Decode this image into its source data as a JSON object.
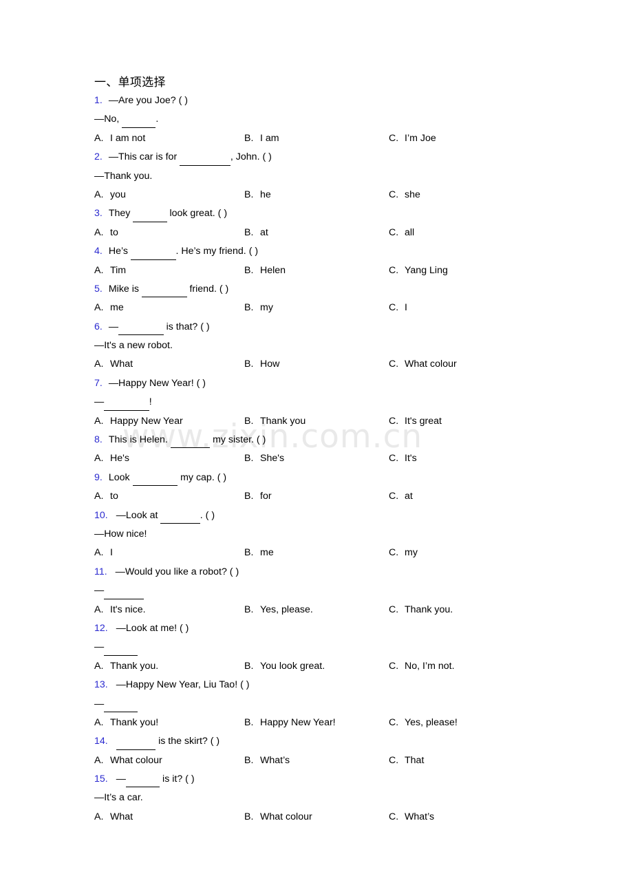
{
  "document": {
    "watermark": "www.zixin.com.cn",
    "heading": "一、单项选择",
    "blue_color": "#2a29cf",
    "text_color": "#000000",
    "watermark_color": "#e9e9e9",
    "background": "#ffffff"
  },
  "questions": [
    {
      "number": "1.",
      "stem": "—Are you Joe? (  )",
      "stem2": "—No, ______.",
      "options": [
        {
          "letter": "A.",
          "text": "I am not"
        },
        {
          "letter": "B.",
          "text": "I am"
        },
        {
          "letter": "C.",
          "text": "I’m Joe"
        }
      ]
    },
    {
      "number": "2.",
      "stem": "—This car is for _________, John. (  )",
      "stem2": "—Thank you.",
      "options": [
        {
          "letter": "A.",
          "text": "you"
        },
        {
          "letter": "B.",
          "text": "he"
        },
        {
          "letter": "C.",
          "text": "she"
        }
      ]
    },
    {
      "number": "3.",
      "stem": "They ______ look great. (  )",
      "stem2": "",
      "options": [
        {
          "letter": "A.",
          "text": "to"
        },
        {
          "letter": "B.",
          "text": "at"
        },
        {
          "letter": "C.",
          "text": "all"
        }
      ]
    },
    {
      "number": "4.",
      "stem": "He’s ________. He’s my friend. (  )",
      "stem2": "",
      "options": [
        {
          "letter": "A.",
          "text": "Tim"
        },
        {
          "letter": "B.",
          "text": "Helen"
        },
        {
          "letter": "C.",
          "text": "Yang Ling"
        }
      ]
    },
    {
      "number": "5.",
      "stem": "Mike is ________ friend. (  )",
      "stem2": "",
      "options": [
        {
          "letter": "A.",
          "text": "me"
        },
        {
          "letter": "B.",
          "text": "my"
        },
        {
          "letter": "C.",
          "text": "I"
        }
      ]
    },
    {
      "number": "6.",
      "stem": "—________ is that? (  )",
      "stem2": "—It's a new robot.",
      "options": [
        {
          "letter": "A.",
          "text": "What"
        },
        {
          "letter": "B.",
          "text": "How"
        },
        {
          "letter": "C.",
          "text": "What colour"
        }
      ]
    },
    {
      "number": "7.",
      "stem": "—Happy New Year! (  )",
      "stem2": "—________!",
      "options": [
        {
          "letter": "A.",
          "text": "Happy New Year"
        },
        {
          "letter": "B.",
          "text": "Thank you"
        },
        {
          "letter": "C.",
          "text": "It's great"
        }
      ]
    },
    {
      "number": "8.",
      "stem": "This is Helen. _______ my sister. (  )",
      "stem2": "",
      "options": [
        {
          "letter": "A.",
          "text": "He's"
        },
        {
          "letter": "B.",
          "text": "She's"
        },
        {
          "letter": "C.",
          "text": "It's"
        }
      ]
    },
    {
      "number": "9.",
      "stem": "Look ________ my cap. (  )",
      "stem2": "",
      "options": [
        {
          "letter": "A.",
          "text": "to"
        },
        {
          "letter": "B.",
          "text": "for"
        },
        {
          "letter": "C.",
          "text": "at"
        }
      ]
    },
    {
      "number": "10.",
      "stem": "—Look at _______. (  )",
      "stem2": "—How nice!",
      "options": [
        {
          "letter": "A.",
          "text": "I"
        },
        {
          "letter": "B.",
          "text": "me"
        },
        {
          "letter": "C.",
          "text": "my"
        }
      ]
    },
    {
      "number": "11.",
      "stem": "—Would you like a robot? (  )",
      "stem2": "—_______",
      "options": [
        {
          "letter": "A.",
          "text": "It's nice."
        },
        {
          "letter": "B.",
          "text": "Yes, please."
        },
        {
          "letter": "C.",
          "text": "Thank you."
        }
      ]
    },
    {
      "number": "12.",
      "stem": "—Look at me! (  )",
      "stem2": "—______",
      "options": [
        {
          "letter": "A.",
          "text": "Thank you."
        },
        {
          "letter": "B.",
          "text": "You look great."
        },
        {
          "letter": "C.",
          "text": "No, I’m not."
        }
      ]
    },
    {
      "number": "13.",
      "stem": "—Happy New Year, Liu Tao! (  )",
      "stem2": "—______",
      "options": [
        {
          "letter": "A.",
          "text": "Thank you!"
        },
        {
          "letter": "B.",
          "text": "Happy New Year!"
        },
        {
          "letter": "C.",
          "text": "Yes, please!"
        }
      ]
    },
    {
      "number": "14.",
      "stem": "_______ is the skirt? (  )",
      "stem2": "",
      "options": [
        {
          "letter": "A.",
          "text": "What colour"
        },
        {
          "letter": "B.",
          "text": "What’s"
        },
        {
          "letter": "C.",
          "text": "That"
        }
      ]
    },
    {
      "number": "15.",
      "stem": "—______ is it? (  )",
      "stem2": "—It’s a car.",
      "options": [
        {
          "letter": "A.",
          "text": "What"
        },
        {
          "letter": "B.",
          "text": "What colour"
        },
        {
          "letter": "C.",
          "text": "What’s"
        }
      ]
    }
  ]
}
